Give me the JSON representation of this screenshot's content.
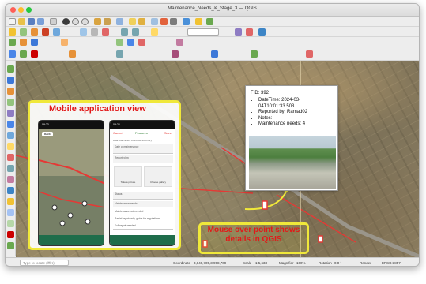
{
  "window": {
    "title": "Maintenance_Needs_&_Stage_3 — QGIS"
  },
  "status": {
    "locator_placeholder": "Type to locate (⌘K)",
    "coordinate_label": "Coordinate",
    "coordinate_value": "3,840,705,3,958,709",
    "scale_label": "Scale",
    "scale_value": "1:5,633",
    "magnifier_label": "Magnifier",
    "magnifier_value": "100%",
    "rotation_label": "Rotation",
    "rotation_value": "0.0 °",
    "render_label": "Render",
    "crs": "EPSG:3857"
  },
  "mobile": {
    "title": "Mobile application view",
    "p1": {
      "time": "09:23",
      "back": "Back"
    },
    "p2": {
      "time": "09:24",
      "cancel": "Cancel",
      "title": "Features",
      "save": "Save",
      "tabs": "Data  Attachment  Workflow Summary",
      "f1": "Date of maintenance",
      "f2": "Reported by",
      "take_photo": "Take a picture",
      "from_gallery": "Choose gallery",
      "f3": "Status",
      "f4": "Maintenance needs",
      "opt1": "Maintenance not needed",
      "opt2": "Partial repair only, guide for regulations",
      "opt3": "Full repair needed"
    }
  },
  "popup": {
    "fid": "FID: 392",
    "items": [
      "DateTime: 2024-03-04T10:01:33.503",
      "Reported by: Ramad02",
      "Notes:",
      "Maintenance needs: 4"
    ]
  },
  "callout": {
    "text": "Mouse over point shows details in QGIS"
  }
}
